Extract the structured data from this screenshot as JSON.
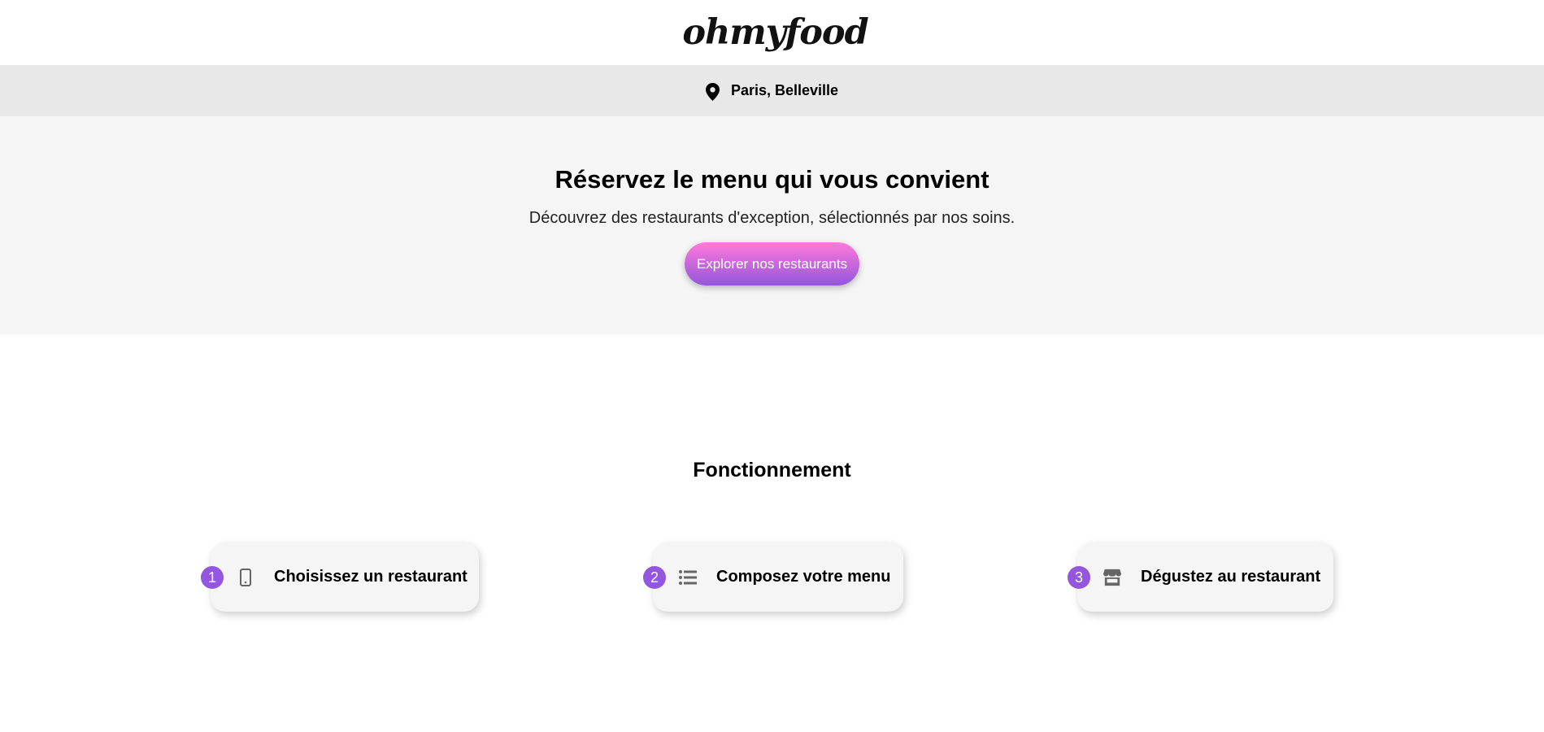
{
  "header": {
    "logo": "ohmyfood"
  },
  "location": {
    "icon": "map-pin-icon",
    "label": "Paris, Belleville"
  },
  "hero": {
    "title": "Réservez le menu qui vous convient",
    "subtitle": "Découvrez des restaurants d'exception, sélectionnés par nos soins.",
    "button_label": "Explorer nos restaurants"
  },
  "how_it_works": {
    "title": "Fonctionnement",
    "steps": [
      {
        "number": "1",
        "icon": "smartphone-icon",
        "label": "Choisissez un restaurant"
      },
      {
        "number": "2",
        "icon": "list-icon",
        "label": "Composez votre menu"
      },
      {
        "number": "3",
        "icon": "store-icon",
        "label": "Dégustez au restaurant"
      }
    ]
  },
  "colors": {
    "accent": "#9356dc",
    "gradient_start": "#ff79da",
    "gradient_end": "#9356dc",
    "location_bar_bg": "#e8e8e8",
    "hero_bg": "#f5f5f5"
  }
}
